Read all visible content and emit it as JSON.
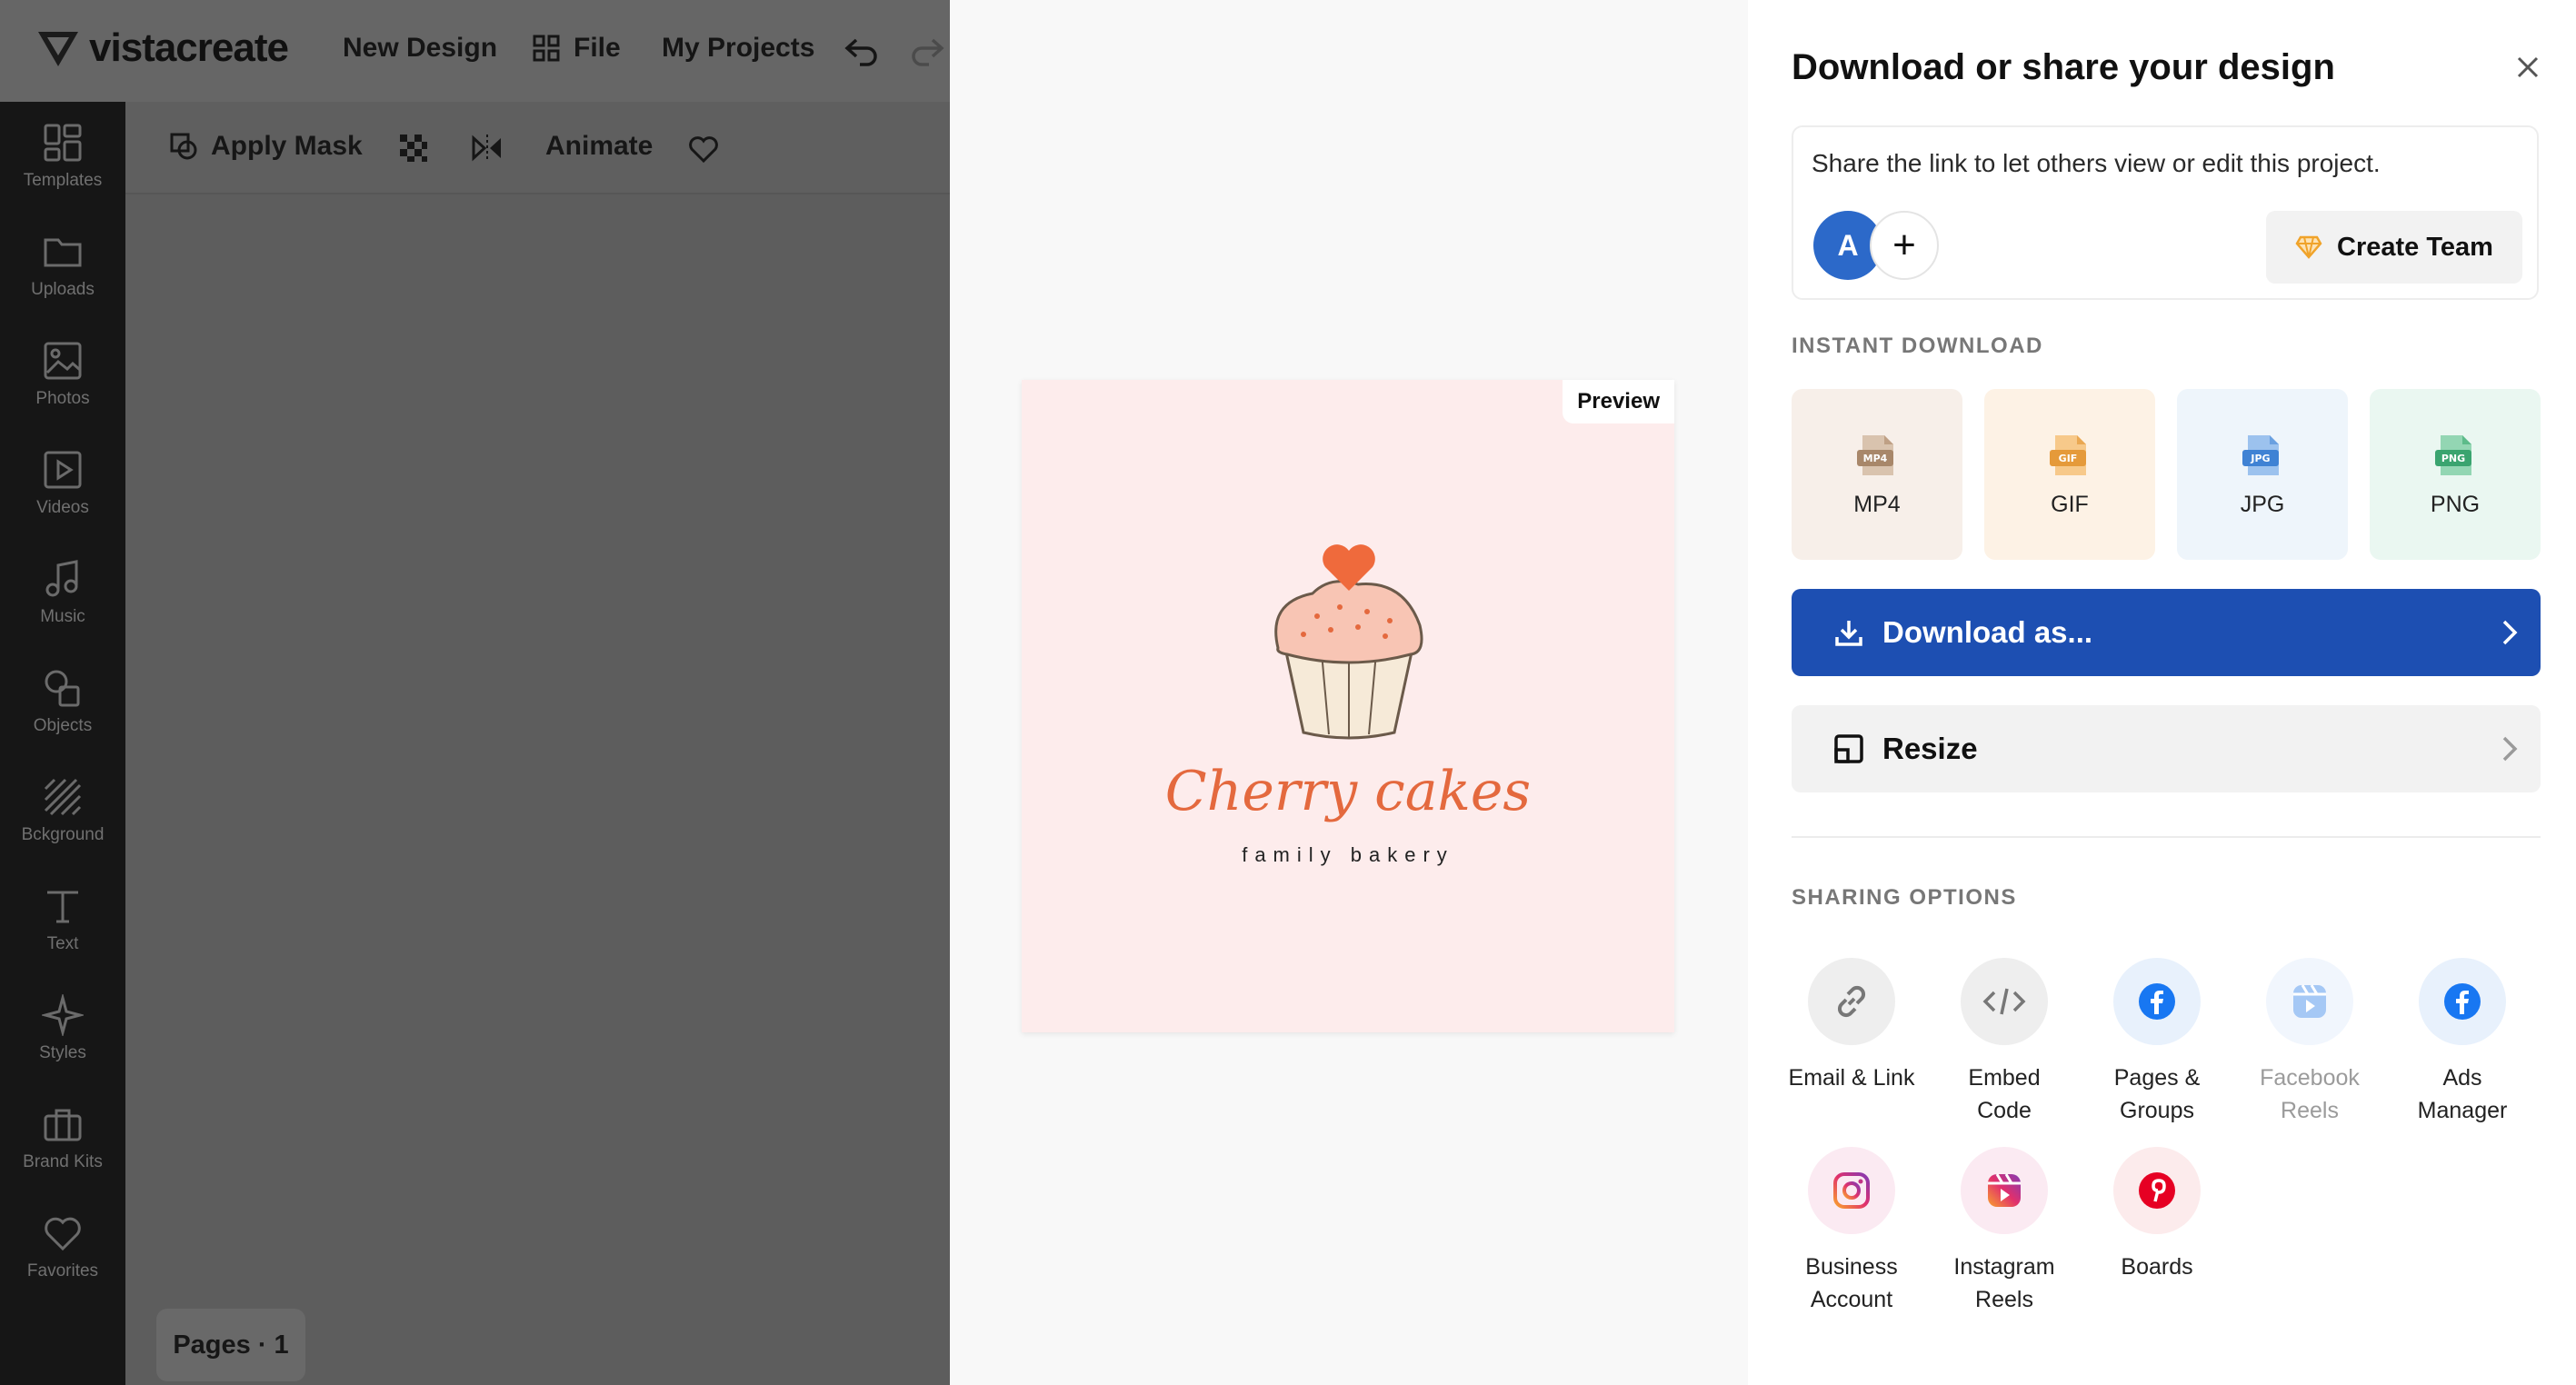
{
  "header": {
    "logo_text": "vistacreate",
    "new_design": "New Design",
    "file": "File",
    "my_projects": "My Projects"
  },
  "sidebar": {
    "items": [
      {
        "label": "Templates",
        "icon": "templates-icon"
      },
      {
        "label": "Uploads",
        "icon": "folder-icon"
      },
      {
        "label": "Photos",
        "icon": "image-icon"
      },
      {
        "label": "Videos",
        "icon": "play-icon"
      },
      {
        "label": "Music",
        "icon": "music-note-icon"
      },
      {
        "label": "Objects",
        "icon": "shapes-icon"
      },
      {
        "label": "Bckground",
        "icon": "stripes-icon"
      },
      {
        "label": "Text",
        "icon": "text-icon"
      },
      {
        "label": "Styles",
        "icon": "sparkle-icon"
      },
      {
        "label": "Brand Kits",
        "icon": "briefcase-icon"
      },
      {
        "label": "Favorites",
        "icon": "heart-icon"
      }
    ]
  },
  "toolbar": {
    "apply_mask": "Apply Mask",
    "animate": "Animate"
  },
  "pages": {
    "label": "Pages · 1"
  },
  "preview": {
    "badge": "Preview",
    "title": "Cherry cakes",
    "subtitle": "family bakery"
  },
  "panel": {
    "title": "Download or share your design",
    "share_text": "Share the link to let others view or edit this project.",
    "avatar_letter": "A",
    "create_team": "Create Team",
    "instant_download_label": "INSTANT DOWNLOAD",
    "formats": [
      {
        "label": "MP4",
        "tag": "MP4",
        "bg": "#f7efe9",
        "icon_color": "#a8876a"
      },
      {
        "label": "GIF",
        "tag": "GIF",
        "bg": "#fdf2e5",
        "icon_color": "#e59a3a"
      },
      {
        "label": "JPG",
        "tag": "JPG",
        "bg": "#eef5fb",
        "icon_color": "#3f82d4"
      },
      {
        "label": "PNG",
        "tag": "PNG",
        "bg": "#eaf7f1",
        "icon_color": "#3aa46f"
      }
    ],
    "download_as": "Download as...",
    "resize": "Resize",
    "sharing_options_label": "SHARING OPTIONS",
    "sharing_options": [
      {
        "label": "Email & Link",
        "icon": "link-icon"
      },
      {
        "label": "Embed\nCode",
        "icon": "code-icon"
      },
      {
        "label": "Pages &\nGroups",
        "icon": "facebook-icon"
      },
      {
        "label": "Facebook\nReels",
        "icon": "facebook-reels-icon"
      },
      {
        "label": "Ads\nManager",
        "icon": "facebook-ads-icon"
      },
      {
        "label": "Business\nAccount",
        "icon": "instagram-icon"
      },
      {
        "label": "Instagram\nReels",
        "icon": "instagram-reels-icon"
      },
      {
        "label": "Boards",
        "icon": "pinterest-icon"
      }
    ]
  },
  "colors": {
    "accent_blue": "#1d4fb2",
    "brand_orange": "#e4693e",
    "card_pink": "#fdecec"
  }
}
